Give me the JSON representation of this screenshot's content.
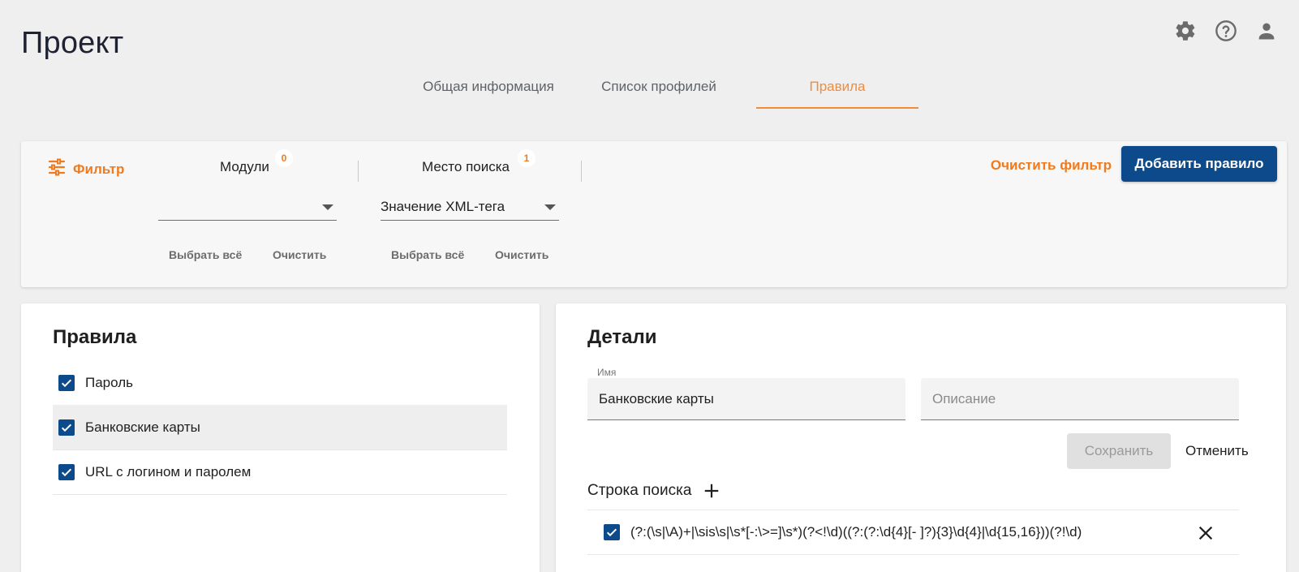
{
  "page": {
    "title": "Проект"
  },
  "tabs": [
    {
      "label": "Общая информация",
      "active": false
    },
    {
      "label": "Список профилей",
      "active": false
    },
    {
      "label": "Правила",
      "active": true
    }
  ],
  "filter": {
    "label": "Фильтр",
    "modules": {
      "title": "Модули",
      "count": "0",
      "value": "",
      "select_all": "Выбрать всё",
      "clear": "Очистить"
    },
    "search_place": {
      "title": "Место поиска",
      "count": "1",
      "value": "Значение XML-тега",
      "select_all": "Выбрать всё",
      "clear": "Очистить"
    },
    "clear_filter": "Очистить фильтр",
    "add_rule": "Добавить правило"
  },
  "rules": {
    "title": "Правила",
    "items": [
      {
        "label": "Пароль",
        "checked": true,
        "selected": false
      },
      {
        "label": "Банковские карты",
        "checked": true,
        "selected": true
      },
      {
        "label": "URL с логином и паролем",
        "checked": true,
        "selected": false
      }
    ]
  },
  "details": {
    "title": "Детали",
    "name_label": "Имя",
    "name_value": "Банковские карты",
    "description_placeholder": "Описание",
    "save": "Сохранить",
    "cancel": "Отменить",
    "search_string_title": "Строка поиска",
    "search_strings": [
      {
        "value": "(?:(\\s|\\A)+|\\sis\\s|\\s*[-:\\>=]\\s*)(?<!\\d)((?:(?:\\d{4}[- ]?){3}\\d{4}|\\d{15,16}))(?!\\d)",
        "checked": true
      }
    ]
  },
  "colors": {
    "accent": "#f07a1d",
    "primary": "#0d4a8c",
    "background": "#efefef"
  },
  "icons": [
    "gear-icon",
    "help-icon",
    "account-icon",
    "filter-icon",
    "plus-icon",
    "close-icon",
    "checkbox-checked-icon",
    "dropdown-arrow-icon"
  ]
}
